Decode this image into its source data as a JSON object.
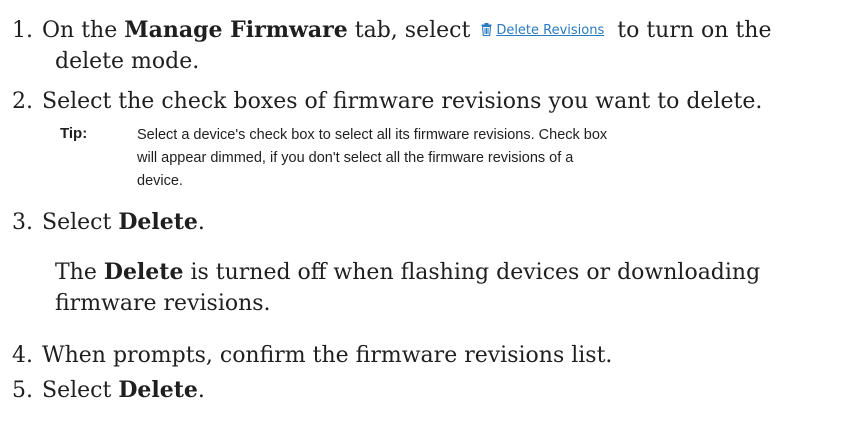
{
  "steps": [
    {
      "num": "1.",
      "pre": "On the ",
      "bold": "Manage Firmware",
      "mid": " tab, select ",
      "link": "Delete Revisions",
      "post": " to turn on the",
      "cont": "delete mode."
    },
    {
      "num": "2.",
      "text": "Select the check boxes of firmware revisions you want to delete."
    },
    {
      "num": "3.",
      "pre": "Select ",
      "bold": "Delete",
      "post": "."
    },
    {
      "num": "4.",
      "text": "When prompts, confirm the firmware revisions list."
    },
    {
      "num": "5.",
      "pre": "Select ",
      "bold": "Delete",
      "post": "."
    }
  ],
  "tip": {
    "label": "Tip:",
    "line1": "Select a device's check box to select all its firmware revisions. Check box",
    "line2": "will appear dimmed, if you don't select all the firmware revisions of a",
    "line3": "device."
  },
  "note": {
    "pre": "The ",
    "bold": "Delete",
    "line1_post": " is turned off when flashing devices or downloading",
    "line2": "firmware revisions."
  },
  "colors": {
    "link": "#2a7ac0",
    "text": "#1f1f1f"
  },
  "icons": {
    "delete_revisions": "trash-icon"
  }
}
